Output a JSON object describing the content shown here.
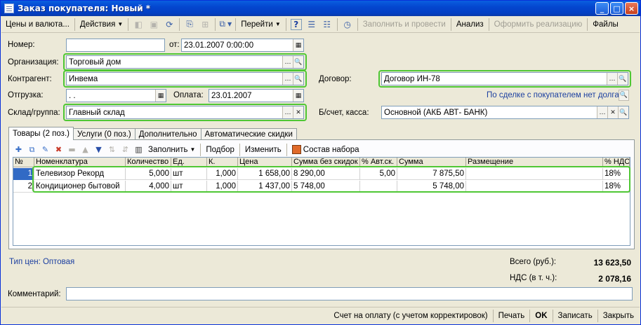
{
  "window": {
    "title": "Заказ покупателя: Новый *",
    "controls": [
      "_",
      "□",
      "×"
    ]
  },
  "toolbar": {
    "prices_currency": "Цены и валюта...",
    "actions": "Действия",
    "goto": "Перейти",
    "help_glyph": "?",
    "fill_and_post": "Заполнить и провести",
    "analysis": "Анализ",
    "create_sale": "Оформить реализацию",
    "files": "Файлы"
  },
  "form": {
    "number_label": "Номер:",
    "number_value": "",
    "from_label": "от:",
    "date_value": "23.01.2007  0:00:00",
    "org_label": "Организация:",
    "org_value": "Торговый дом",
    "counterparty_label": "Контрагент:",
    "counterparty_value": "Инвема",
    "contract_label": "Договор:",
    "contract_value": "Договор ИН-78",
    "shipment_label": "Отгрузка:",
    "shipment_value": " .  .",
    "payment_label": "Оплата:",
    "payment_value": "23.01.2007",
    "debt_info": "По сделке с покупателем нет долга",
    "warehouse_label": "Склад/группа:",
    "warehouse_value": "Главный склад",
    "account_label": "Б/счет, касса:",
    "account_value": "Основной  (АКБ АВТ- БАНК)"
  },
  "tabs": [
    {
      "label": "Товары (2 поз.)",
      "active": true
    },
    {
      "label": "Услуги (0 поз.)",
      "active": false
    },
    {
      "label": "Дополнительно",
      "active": false
    },
    {
      "label": "Автоматические скидки",
      "active": false
    }
  ],
  "subtoolbar": {
    "fill": "Заполнить",
    "select": "Подбор",
    "change": "Изменить",
    "kit": "Состав набора"
  },
  "table": {
    "columns": [
      "№",
      "Номенклатура",
      "Количество",
      "Ед.",
      "К.",
      "Цена",
      "Сумма без скидок",
      "% Авт.ск.",
      "Сумма",
      "Размещение",
      "% НДС"
    ],
    "rows": [
      [
        "1",
        "Телевизор Рекорд",
        "5,000",
        "шт",
        "1,000",
        "1 658,00",
        "8 290,00",
        "5,00",
        "7 875,50",
        "",
        "18%"
      ],
      [
        "2",
        "Кондиционер бытовой",
        "4,000",
        "шт",
        "1,000",
        "1 437,00",
        "5 748,00",
        "",
        "5 748,00",
        "",
        "18%"
      ]
    ]
  },
  "footer": {
    "price_type": "Тип цен: Оптовая",
    "total_label": "Всего (руб.):",
    "total_value": "13 623,50",
    "vat_label": "НДС (в т. ч.):",
    "vat_value": "2 078,16",
    "comment_label": "Комментарий:",
    "comment_value": ""
  },
  "bottom": {
    "invoice": "Счет на оплату (с учетом корректировок)",
    "print": "Печать",
    "ok": "OK",
    "save": "Записать",
    "close": "Закрыть"
  },
  "colors": {
    "highlight": "#4fc734",
    "titlebar": "#0446cf",
    "selection": "#316ac5",
    "link": "#1b3fa0"
  }
}
